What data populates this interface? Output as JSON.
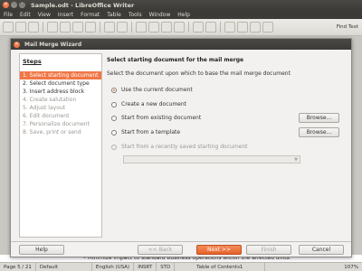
{
  "window": {
    "title": "Sample.odt - LibreOffice Writer"
  },
  "menubar": {
    "items": [
      "File",
      "Edit",
      "View",
      "Insert",
      "Format",
      "Table",
      "Tools",
      "Window",
      "Help"
    ]
  },
  "toolbar": {
    "find_label": "Find Text"
  },
  "document": {
    "visible_text": "–  Minimize impact to standard business operations within the affected units."
  },
  "dialog": {
    "title": "Mail Merge Wizard",
    "steps_title": "Steps",
    "steps": [
      {
        "label": "1. Select starting document",
        "state": "active"
      },
      {
        "label": "2. Select document type",
        "state": "enabled"
      },
      {
        "label": "3. Insert address block",
        "state": "enabled"
      },
      {
        "label": "4. Create salutation",
        "state": "disabled"
      },
      {
        "label": "5. Adjust layout",
        "state": "disabled"
      },
      {
        "label": "6. Edit document",
        "state": "disabled"
      },
      {
        "label": "7. Personalize document",
        "state": "disabled"
      },
      {
        "label": "8. Save, print or send",
        "state": "disabled"
      }
    ],
    "heading": "Select starting document for the mail merge",
    "description": "Select the document upon which to base the mail merge document",
    "options": {
      "current": "Use the current document",
      "new": "Create a new document",
      "existing": "Start from existing document",
      "template": "Start from a template",
      "recent": "Start from a recently saved starting document"
    },
    "browse_label": "Browse...",
    "buttons": {
      "help": "Help",
      "back": "<< Back",
      "next": "Next >>",
      "finish": "Finish",
      "cancel": "Cancel"
    }
  },
  "statusbar": {
    "page": "Page 5 / 21",
    "style": "Default",
    "language": "English (USA)",
    "mode": "INSRT",
    "selection": "STD",
    "section": "Table of Contents1",
    "zoom": "107%"
  },
  "colors": {
    "accent": "#f07746",
    "titlebar": "#3c3b37"
  }
}
